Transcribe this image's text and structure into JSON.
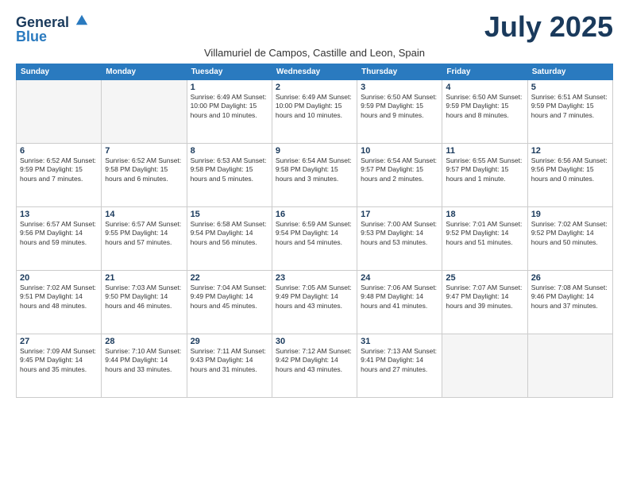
{
  "logo": {
    "general": "General",
    "blue": "Blue"
  },
  "title": "July 2025",
  "location": "Villamuriel de Campos, Castille and Leon, Spain",
  "weekdays": [
    "Sunday",
    "Monday",
    "Tuesday",
    "Wednesday",
    "Thursday",
    "Friday",
    "Saturday"
  ],
  "weeks": [
    [
      {
        "day": "",
        "info": ""
      },
      {
        "day": "",
        "info": ""
      },
      {
        "day": "1",
        "info": "Sunrise: 6:49 AM\nSunset: 10:00 PM\nDaylight: 15 hours\nand 10 minutes."
      },
      {
        "day": "2",
        "info": "Sunrise: 6:49 AM\nSunset: 10:00 PM\nDaylight: 15 hours\nand 10 minutes."
      },
      {
        "day": "3",
        "info": "Sunrise: 6:50 AM\nSunset: 9:59 PM\nDaylight: 15 hours\nand 9 minutes."
      },
      {
        "day": "4",
        "info": "Sunrise: 6:50 AM\nSunset: 9:59 PM\nDaylight: 15 hours\nand 8 minutes."
      },
      {
        "day": "5",
        "info": "Sunrise: 6:51 AM\nSunset: 9:59 PM\nDaylight: 15 hours\nand 7 minutes."
      }
    ],
    [
      {
        "day": "6",
        "info": "Sunrise: 6:52 AM\nSunset: 9:59 PM\nDaylight: 15 hours\nand 7 minutes."
      },
      {
        "day": "7",
        "info": "Sunrise: 6:52 AM\nSunset: 9:58 PM\nDaylight: 15 hours\nand 6 minutes."
      },
      {
        "day": "8",
        "info": "Sunrise: 6:53 AM\nSunset: 9:58 PM\nDaylight: 15 hours\nand 5 minutes."
      },
      {
        "day": "9",
        "info": "Sunrise: 6:54 AM\nSunset: 9:58 PM\nDaylight: 15 hours\nand 3 minutes."
      },
      {
        "day": "10",
        "info": "Sunrise: 6:54 AM\nSunset: 9:57 PM\nDaylight: 15 hours\nand 2 minutes."
      },
      {
        "day": "11",
        "info": "Sunrise: 6:55 AM\nSunset: 9:57 PM\nDaylight: 15 hours\nand 1 minute."
      },
      {
        "day": "12",
        "info": "Sunrise: 6:56 AM\nSunset: 9:56 PM\nDaylight: 15 hours\nand 0 minutes."
      }
    ],
    [
      {
        "day": "13",
        "info": "Sunrise: 6:57 AM\nSunset: 9:56 PM\nDaylight: 14 hours\nand 59 minutes."
      },
      {
        "day": "14",
        "info": "Sunrise: 6:57 AM\nSunset: 9:55 PM\nDaylight: 14 hours\nand 57 minutes."
      },
      {
        "day": "15",
        "info": "Sunrise: 6:58 AM\nSunset: 9:54 PM\nDaylight: 14 hours\nand 56 minutes."
      },
      {
        "day": "16",
        "info": "Sunrise: 6:59 AM\nSunset: 9:54 PM\nDaylight: 14 hours\nand 54 minutes."
      },
      {
        "day": "17",
        "info": "Sunrise: 7:00 AM\nSunset: 9:53 PM\nDaylight: 14 hours\nand 53 minutes."
      },
      {
        "day": "18",
        "info": "Sunrise: 7:01 AM\nSunset: 9:52 PM\nDaylight: 14 hours\nand 51 minutes."
      },
      {
        "day": "19",
        "info": "Sunrise: 7:02 AM\nSunset: 9:52 PM\nDaylight: 14 hours\nand 50 minutes."
      }
    ],
    [
      {
        "day": "20",
        "info": "Sunrise: 7:02 AM\nSunset: 9:51 PM\nDaylight: 14 hours\nand 48 minutes."
      },
      {
        "day": "21",
        "info": "Sunrise: 7:03 AM\nSunset: 9:50 PM\nDaylight: 14 hours\nand 46 minutes."
      },
      {
        "day": "22",
        "info": "Sunrise: 7:04 AM\nSunset: 9:49 PM\nDaylight: 14 hours\nand 45 minutes."
      },
      {
        "day": "23",
        "info": "Sunrise: 7:05 AM\nSunset: 9:49 PM\nDaylight: 14 hours\nand 43 minutes."
      },
      {
        "day": "24",
        "info": "Sunrise: 7:06 AM\nSunset: 9:48 PM\nDaylight: 14 hours\nand 41 minutes."
      },
      {
        "day": "25",
        "info": "Sunrise: 7:07 AM\nSunset: 9:47 PM\nDaylight: 14 hours\nand 39 minutes."
      },
      {
        "day": "26",
        "info": "Sunrise: 7:08 AM\nSunset: 9:46 PM\nDaylight: 14 hours\nand 37 minutes."
      }
    ],
    [
      {
        "day": "27",
        "info": "Sunrise: 7:09 AM\nSunset: 9:45 PM\nDaylight: 14 hours\nand 35 minutes."
      },
      {
        "day": "28",
        "info": "Sunrise: 7:10 AM\nSunset: 9:44 PM\nDaylight: 14 hours\nand 33 minutes."
      },
      {
        "day": "29",
        "info": "Sunrise: 7:11 AM\nSunset: 9:43 PM\nDaylight: 14 hours\nand 31 minutes."
      },
      {
        "day": "30",
        "info": "Sunrise: 7:12 AM\nSunset: 9:42 PM\nDaylight: 14 hours\nand 43 minutes."
      },
      {
        "day": "31",
        "info": "Sunrise: 7:13 AM\nSunset: 9:41 PM\nDaylight: 14 hours\nand 27 minutes."
      },
      {
        "day": "",
        "info": ""
      },
      {
        "day": "",
        "info": ""
      }
    ]
  ]
}
